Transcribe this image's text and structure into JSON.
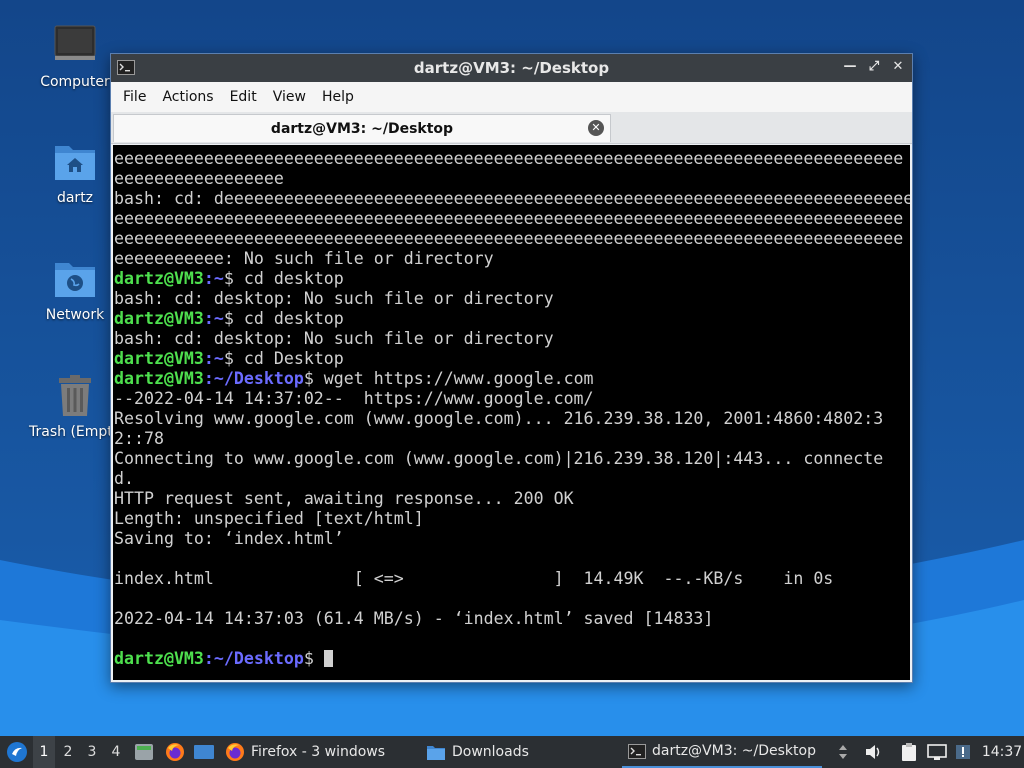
{
  "desktop": {
    "icons": [
      {
        "label": "Computer",
        "icon": "computer-icon"
      },
      {
        "label": "dartz",
        "icon": "home-folder-icon"
      },
      {
        "label": "Network",
        "icon": "network-folder-icon"
      },
      {
        "label": "Trash (Empty)",
        "icon": "trash-icon"
      }
    ]
  },
  "window": {
    "title": "dartz@VM3: ~/Desktop",
    "menu": [
      "File",
      "Actions",
      "Edit",
      "View",
      "Help"
    ],
    "tab_title": "dartz@VM3: ~/Desktop"
  },
  "terminal": {
    "prompt_user": "dartz@VM3",
    "lines": [
      "eeeeeeeeeeeeeeeeeeeeeeeeeeeeeeeeeeeeeeeeeeeeeeeeeeeeeeeeeeeeeeeeeeeeeeeeeeeeeee",
      "eeeeeeeeeeeeeeeee",
      "bash: cd: deeeeeeeeeeeeeeeeeeeeeeeeeeeeeeeeeeeeeeeeeeeeeeeeeeeeeeeeeeeeeeeeeeeeee",
      "eeeeeeeeeeeeeeeeeeeeeeeeeeeeeeeeeeeeeeeeeeeeeeeeeeeeeeeeeeeeeeeeeeeeeeeeeeeeeee",
      "eeeeeeeeeeeeeeeeeeeeeeeeeeeeeeeeeeeeeeeeeeeeeeeeeeeeeeeeeeeeeeeeeeeeeeeeeeeeeee",
      "eeeeeeeeeee: No such file or directory",
      {
        "user": "dartz@VM3",
        "path": ":~",
        "cmd": "$ cd desktop"
      },
      "bash: cd: desktop: No such file or directory",
      {
        "user": "dartz@VM3",
        "path": ":~",
        "cmd": "$ cd desktop"
      },
      "bash: cd: desktop: No such file or directory",
      {
        "user": "dartz@VM3",
        "path": ":~",
        "cmd": "$ cd Desktop"
      },
      {
        "user": "dartz@VM3",
        "path": ":~/Desktop",
        "cmd": "$ wget https://www.google.com"
      },
      "--2022-04-14 14:37:02--  https://www.google.com/",
      "Resolving www.google.com (www.google.com)... 216.239.38.120, 2001:4860:4802:3",
      "2::78",
      "Connecting to www.google.com (www.google.com)|216.239.38.120|:443... connecte",
      "d.",
      "HTTP request sent, awaiting response... 200 OK",
      "Length: unspecified [text/html]",
      "Saving to: ‘index.html’",
      "",
      "index.html              [ <=>               ]  14.49K  --.-KB/s    in 0s",
      "",
      "2022-04-14 14:37:03 (61.4 MB/s) - ‘index.html’ saved [14833]",
      "",
      {
        "user": "dartz@VM3",
        "path": ":~/Desktop",
        "cmd": "$ ",
        "cursor": true
      }
    ]
  },
  "taskbar": {
    "workspaces": [
      "1",
      "2",
      "3",
      "4"
    ],
    "active_workspace": "1",
    "tasks": [
      {
        "label": "Firefox - 3 windows",
        "icon": "firefox-icon"
      },
      {
        "label": "Downloads",
        "icon": "folder-icon"
      },
      {
        "label": "dartz@VM3: ~/Desktop",
        "icon": "terminal-icon"
      }
    ],
    "clock": "14:37"
  },
  "colors": {
    "prompt_user": "#4ee04e",
    "prompt_path": "#6b6bff",
    "terminal_bg": "#000000",
    "taskbar_bg": "#2b2f33"
  }
}
